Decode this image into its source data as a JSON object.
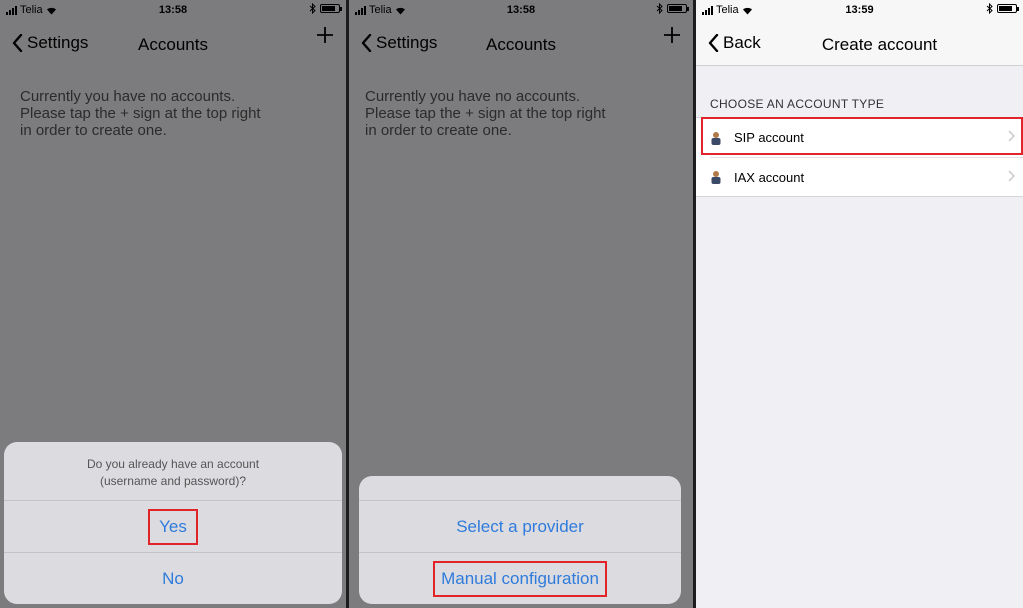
{
  "colors": {
    "ios_blue": "#2f7bdc",
    "highlight_red": "#e0242a",
    "dim_bg": "#7c7c7e",
    "grouped_bg": "#efeff4"
  },
  "panel1": {
    "status": {
      "carrier": "Telia",
      "time": "13:58"
    },
    "nav": {
      "back_label": "Settings",
      "title": "Accounts",
      "action_icon": "plus-icon"
    },
    "message": [
      "Currently you have no accounts.",
      "Please tap the + sign at the top right",
      "in order to create one."
    ],
    "sheet": {
      "question": [
        "Do you already have an account",
        "(username and password)?"
      ],
      "yes_label": "Yes",
      "no_label": "No"
    }
  },
  "panel2": {
    "status": {
      "carrier": "Telia",
      "time": "13:58"
    },
    "nav": {
      "back_label": "Settings",
      "title": "Accounts",
      "action_icon": "plus-icon"
    },
    "message": [
      "Currently you have no accounts.",
      "Please tap the + sign at the top right",
      "in order to create one."
    ],
    "sheet": {
      "provider_label": "Select a provider",
      "manual_label": "Manual configuration"
    }
  },
  "panel3": {
    "status": {
      "carrier": "Telia",
      "time": "13:59"
    },
    "nav": {
      "back_label": "Back",
      "title": "Create account"
    },
    "section_header": "CHOOSE AN ACCOUNT TYPE",
    "items": [
      {
        "label": "SIP account",
        "icon": "person-icon"
      },
      {
        "label": "IAX account",
        "icon": "person-icon"
      }
    ]
  }
}
